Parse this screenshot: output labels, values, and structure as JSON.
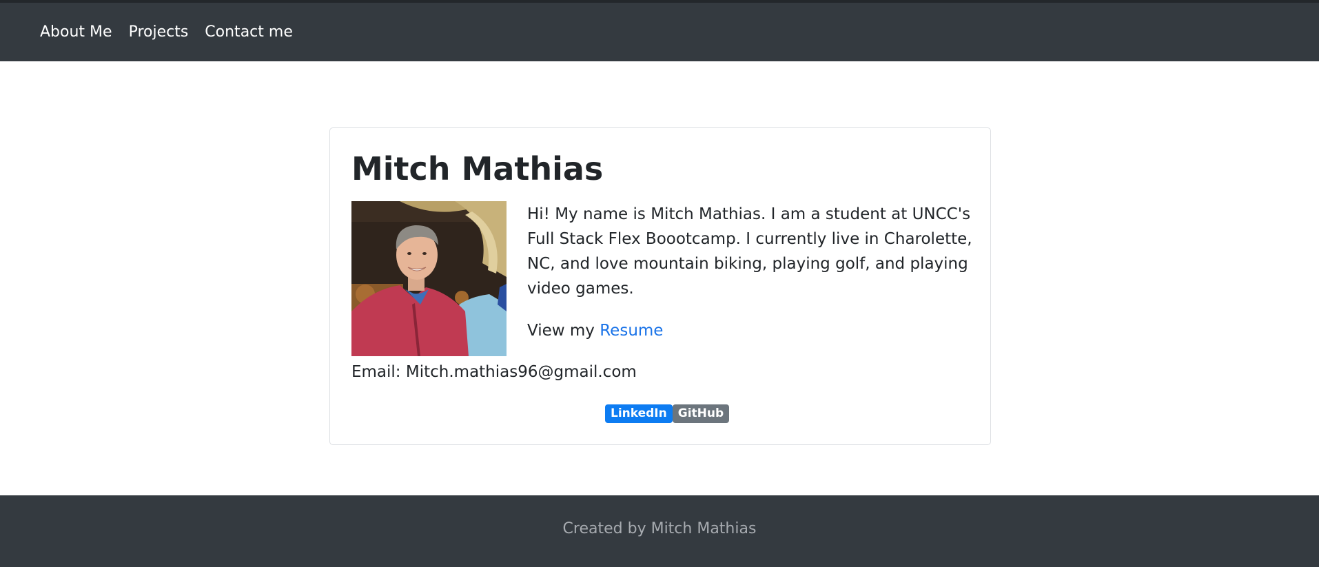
{
  "nav": {
    "items": [
      {
        "label": "About Me"
      },
      {
        "label": "Projects"
      },
      {
        "label": "Contact me"
      }
    ]
  },
  "profile": {
    "name": "Mitch Mathias",
    "bio": "Hi! My name is Mitch Mathias. I am a student at UNCC's Full Stack Flex Boootcamp. I currently live in Charolette, NC, and love mountain biking, playing golf, and playing video games.",
    "resume_prefix": "View my",
    "resume_link": "Resume",
    "email_line": "Email: Mitch.mathias96@gmail.com",
    "badges": {
      "linkedin": "LinkedIn",
      "github": "GitHub"
    }
  },
  "footer": {
    "text": "Created by Mitch Mathias"
  },
  "colors": {
    "navbar": "#343a40",
    "link": "#1a73e8",
    "badge_primary": "#0d7cf2",
    "badge_secondary": "#6c757d"
  }
}
